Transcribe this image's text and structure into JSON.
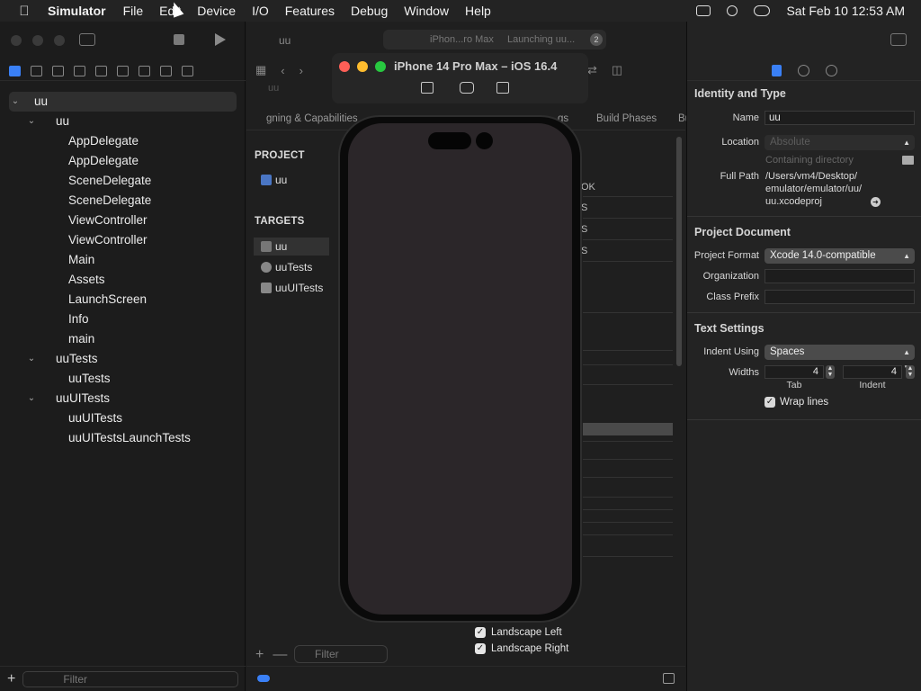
{
  "menubar": {
    "app_name": "Simulator",
    "items": [
      "File",
      "Edit",
      "Device",
      "I/O",
      "Features",
      "Debug",
      "Window",
      "Help"
    ],
    "datetime": "Sat Feb 10  12:53 AM"
  },
  "navigator": {
    "tree": [
      {
        "label": "uu",
        "level": 0,
        "expanded": true,
        "selected": true
      },
      {
        "label": "uu",
        "level": 1,
        "expanded": true
      },
      {
        "label": "AppDelegate",
        "level": 2
      },
      {
        "label": "AppDelegate",
        "level": 2
      },
      {
        "label": "SceneDelegate",
        "level": 2
      },
      {
        "label": "SceneDelegate",
        "level": 2
      },
      {
        "label": "ViewController",
        "level": 2
      },
      {
        "label": "ViewController",
        "level": 2
      },
      {
        "label": "Main",
        "level": 2
      },
      {
        "label": "Assets",
        "level": 2
      },
      {
        "label": "LaunchScreen",
        "level": 2
      },
      {
        "label": "Info",
        "level": 2
      },
      {
        "label": "main",
        "level": 2
      },
      {
        "label": "uuTests",
        "level": 1,
        "expanded": true
      },
      {
        "label": "uuTests",
        "level": 2
      },
      {
        "label": "uuUITests",
        "level": 1,
        "expanded": true
      },
      {
        "label": "uuUITests",
        "level": 2
      },
      {
        "label": "uuUITestsLaunchTests",
        "level": 2
      }
    ],
    "filter_placeholder": "Filter"
  },
  "toolbar": {
    "scheme": "uu",
    "activity_device": "iPhon...ro Max",
    "activity_status": "Launching uu...",
    "activity_badge": "2"
  },
  "editor": {
    "jumpbar": "uu",
    "subtabs": [
      "gning & Capabilities",
      "gs",
      "Build Phases",
      "Bu"
    ],
    "project_header": "PROJECT",
    "project_item": "uu",
    "targets_header": "TARGETS",
    "targets": [
      "uu",
      "uuTests",
      "uuUITests"
    ],
    "filter_placeholder": "Filter",
    "partial_rows": [
      "OK",
      "S",
      "S",
      "S"
    ],
    "orientations": [
      {
        "label": "Landscape Left",
        "checked": true
      },
      {
        "label": "Landscape Right",
        "checked": true
      }
    ]
  },
  "simulator": {
    "title": "iPhone 14 Pro Max – iOS 16.4",
    "buttons": [
      "home-icon",
      "screenshot-icon",
      "rotate-icon"
    ]
  },
  "inspector": {
    "identity_header": "Identity and Type",
    "name_label": "Name",
    "name_value": "uu",
    "location_label": "Location",
    "location_value": "Absolute",
    "containing_hint": "Containing directory",
    "full_path_label": "Full Path",
    "full_path_lines": [
      "/Users/vm4/Desktop/",
      "emulator/emulator/uu/",
      "uu.xcodeproj"
    ],
    "project_doc_header": "Project Document",
    "project_format_label": "Project Format",
    "project_format_value": "Xcode 14.0-compatible",
    "organization_label": "Organization",
    "organization_value": "",
    "class_prefix_label": "Class Prefix",
    "class_prefix_value": "",
    "text_settings_header": "Text Settings",
    "indent_using_label": "Indent Using",
    "indent_using_value": "Spaces",
    "widths_label": "Widths",
    "tab_value": "4",
    "indent_value": "4",
    "tab_label": "Tab",
    "indent_label": "Indent",
    "wrap_lines_label": "Wrap lines",
    "wrap_lines_checked": true
  }
}
